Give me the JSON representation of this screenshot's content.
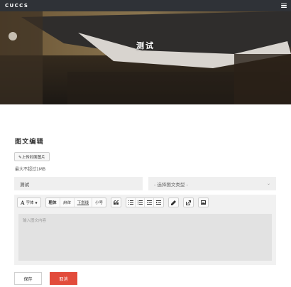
{
  "header": {
    "brand": "CUCCS",
    "menu_icon": "hamburger-menu-icon"
  },
  "hero": {
    "title": "测试"
  },
  "form": {
    "section_title": "图文编辑",
    "upload_button": "✎上传封面图片",
    "size_note": "最大不超过1MB",
    "title_value": "测试",
    "type_select": "- 选择图文类型 -"
  },
  "toolbar": {
    "font": "字体",
    "bold": "粗体",
    "italic": "斜体",
    "underline": "下划线",
    "small": "小号"
  },
  "editor": {
    "placeholder": "输入图文内容"
  },
  "actions": {
    "save": "保存",
    "cancel": "取消"
  },
  "colors": {
    "topbar": "#2f3237",
    "cancel": "#e24b3b",
    "input_bg": "#efefef"
  }
}
